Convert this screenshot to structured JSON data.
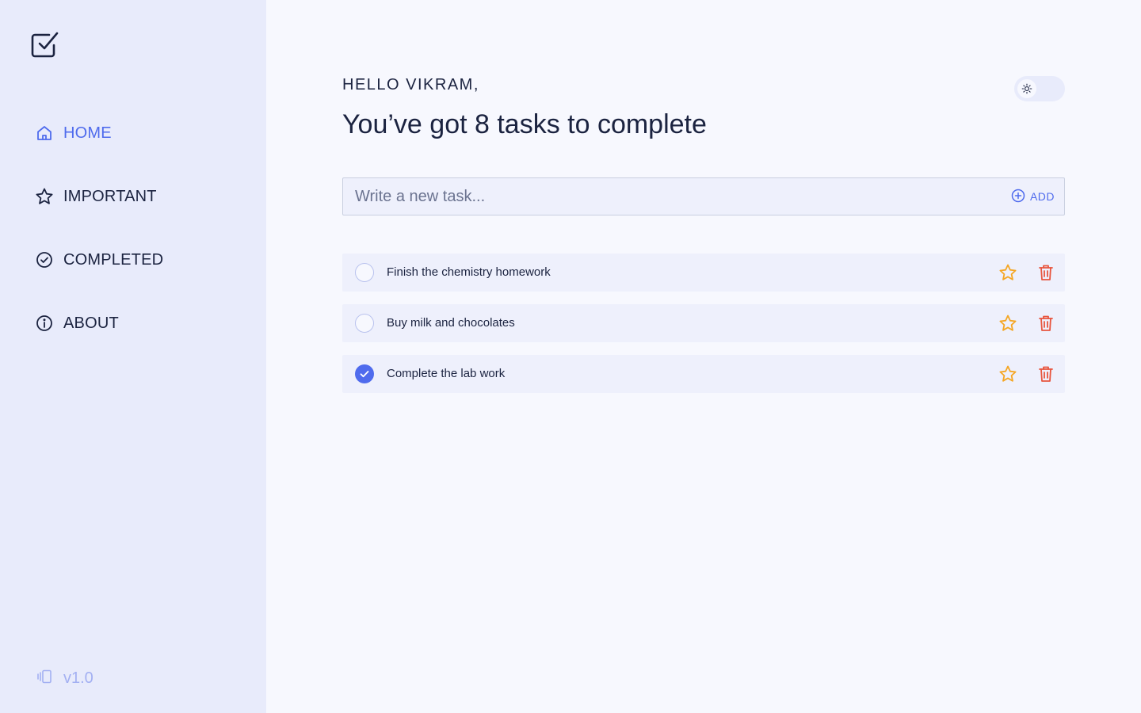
{
  "sidebar": {
    "logo_icon": "checkbox-icon",
    "items": [
      {
        "label": "HOME",
        "icon": "home-icon",
        "active": true
      },
      {
        "label": "IMPORTANT",
        "icon": "star-icon",
        "active": false
      },
      {
        "label": "COMPLETED",
        "icon": "check-circle-icon",
        "active": false
      },
      {
        "label": "ABOUT",
        "icon": "info-icon",
        "active": false
      }
    ],
    "version": "v1.0",
    "version_icon": "vibrate-icon"
  },
  "header": {
    "greeting": "HELLO VIKRAM,",
    "headline": "You’ve got 8 tasks to complete",
    "theme_toggle_icon": "sun-icon"
  },
  "new_task": {
    "placeholder": "Write a new task...",
    "value": "",
    "add_label": "ADD"
  },
  "tasks": [
    {
      "text": "Finish the chemistry homework",
      "completed": false
    },
    {
      "text": "Buy milk and chocolates",
      "completed": false
    },
    {
      "text": "Complete the lab work",
      "completed": true
    }
  ],
  "colors": {
    "accent": "#4f6bed",
    "sidebar_bg": "#e8ebfb",
    "page_bg": "#f7f8fe",
    "star": "#f5a623",
    "delete": "#e8553e",
    "text": "#1b2340"
  }
}
